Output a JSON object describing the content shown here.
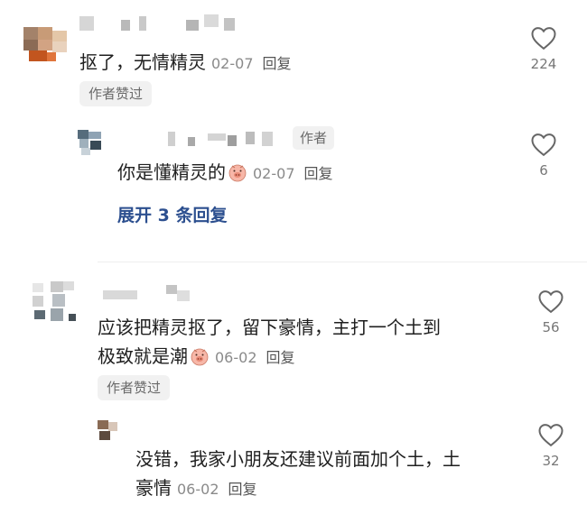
{
  "colors": {
    "link": "#2c4f8f",
    "meta": "#8a8a8a",
    "badge_bg": "#f1f1f1"
  },
  "comments": [
    {
      "text": "抠了，无情精灵",
      "date": "02-07",
      "reply_label": "回复",
      "likes": "224",
      "badge": "作者赞过"
    },
    {
      "text": "你是懂精灵的",
      "date": "02-07",
      "reply_label": "回复",
      "likes": "6",
      "author_tag": "作者",
      "emoji": "pig-face-emoji"
    },
    {
      "text_line1": "应该把精灵抠了，留下豪情，主打一个土到",
      "text_line2": "极致就是潮",
      "date": "06-02",
      "reply_label": "回复",
      "likes": "56",
      "badge": "作者赞过",
      "emoji": "pig-face-emoji"
    },
    {
      "text_line1": "没错，我家小朋友还建议前面加个土，土",
      "text_line2": "豪情",
      "date": "06-02",
      "reply_label": "回复",
      "likes": "32"
    }
  ],
  "expand_replies": "展开 3 条回复"
}
